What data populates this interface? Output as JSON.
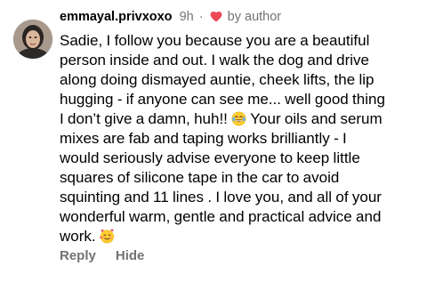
{
  "comment": {
    "username": "emmayal.privxoxo",
    "time": "9h",
    "separator": "·",
    "author_badge": "by author",
    "text_parts": [
      "Sadie, I follow you because you are a beautiful\nperson inside and out. I walk the dog and drive\nalong doing dismayed auntie, cheek lifts, the lip\nhugging - if anyone can see me... well good thing\nI don’t give a damn, huh!! ",
      " Your oils and serum\nmixes are fab and taping works brilliantly - I\nwould seriously advise everyone to keep little\nsquares of silicone tape in the car to avoid\nsquinting and 11 lines . I love you,  and all of your\nwonderful warm, gentle and practical advice and\nwork. "
    ],
    "emojis": [
      "tears-of-joy-emoji",
      "smiling-face-with-hearts-emoji"
    ],
    "icons": {
      "author_heart": "red-heart-icon"
    },
    "colors": {
      "heart": "#ed4956",
      "muted": "#737373"
    }
  },
  "actions": {
    "reply_label": "Reply",
    "hide_label": "Hide"
  }
}
